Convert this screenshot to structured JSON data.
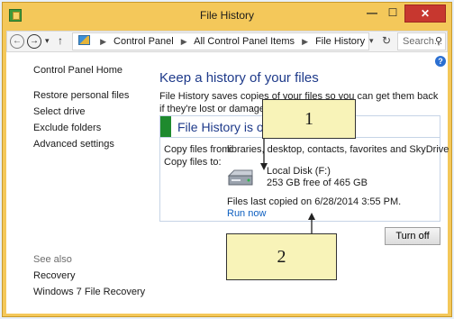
{
  "window": {
    "title": "File History",
    "buttons": {
      "minimize": "—",
      "maximize": "☐",
      "close": "✕"
    }
  },
  "address_bar": {
    "breadcrumbs": [
      "Control Panel",
      "All Control Panel Items",
      "File History"
    ],
    "search_placeholder": "Search...",
    "icons": {
      "back": "back-arrow-icon",
      "forward": "forward-arrow-icon",
      "up": "up-arrow-icon",
      "refresh": "refresh-icon",
      "search": "search-icon"
    }
  },
  "sidebar": {
    "home": "Control Panel Home",
    "items": [
      "Restore personal files",
      "Select drive",
      "Exclude folders",
      "Advanced settings"
    ],
    "see_also_label": "See also",
    "see_also_items": [
      "Recovery",
      "Windows 7 File Recovery"
    ]
  },
  "main": {
    "heading": "Keep a history of your files",
    "description": "File History saves copies of your files so you can get them back if they're lost or damaged.",
    "status": "File History is on",
    "status_color": "#1e8a2e",
    "copy_from_label": "Copy files from:",
    "copy_from_value": "libraries, desktop, contacts, favorites and SkyDrive",
    "copy_to_label": "Copy files to:",
    "drive_name": "Local Disk (F:)",
    "drive_space": "253 GB free of 465 GB",
    "last_copied": "Files last copied on 6/28/2014 3:55 PM.",
    "run_now": "Run now",
    "turn_off": "Turn off"
  },
  "callouts": {
    "one": "1",
    "two": "2"
  }
}
